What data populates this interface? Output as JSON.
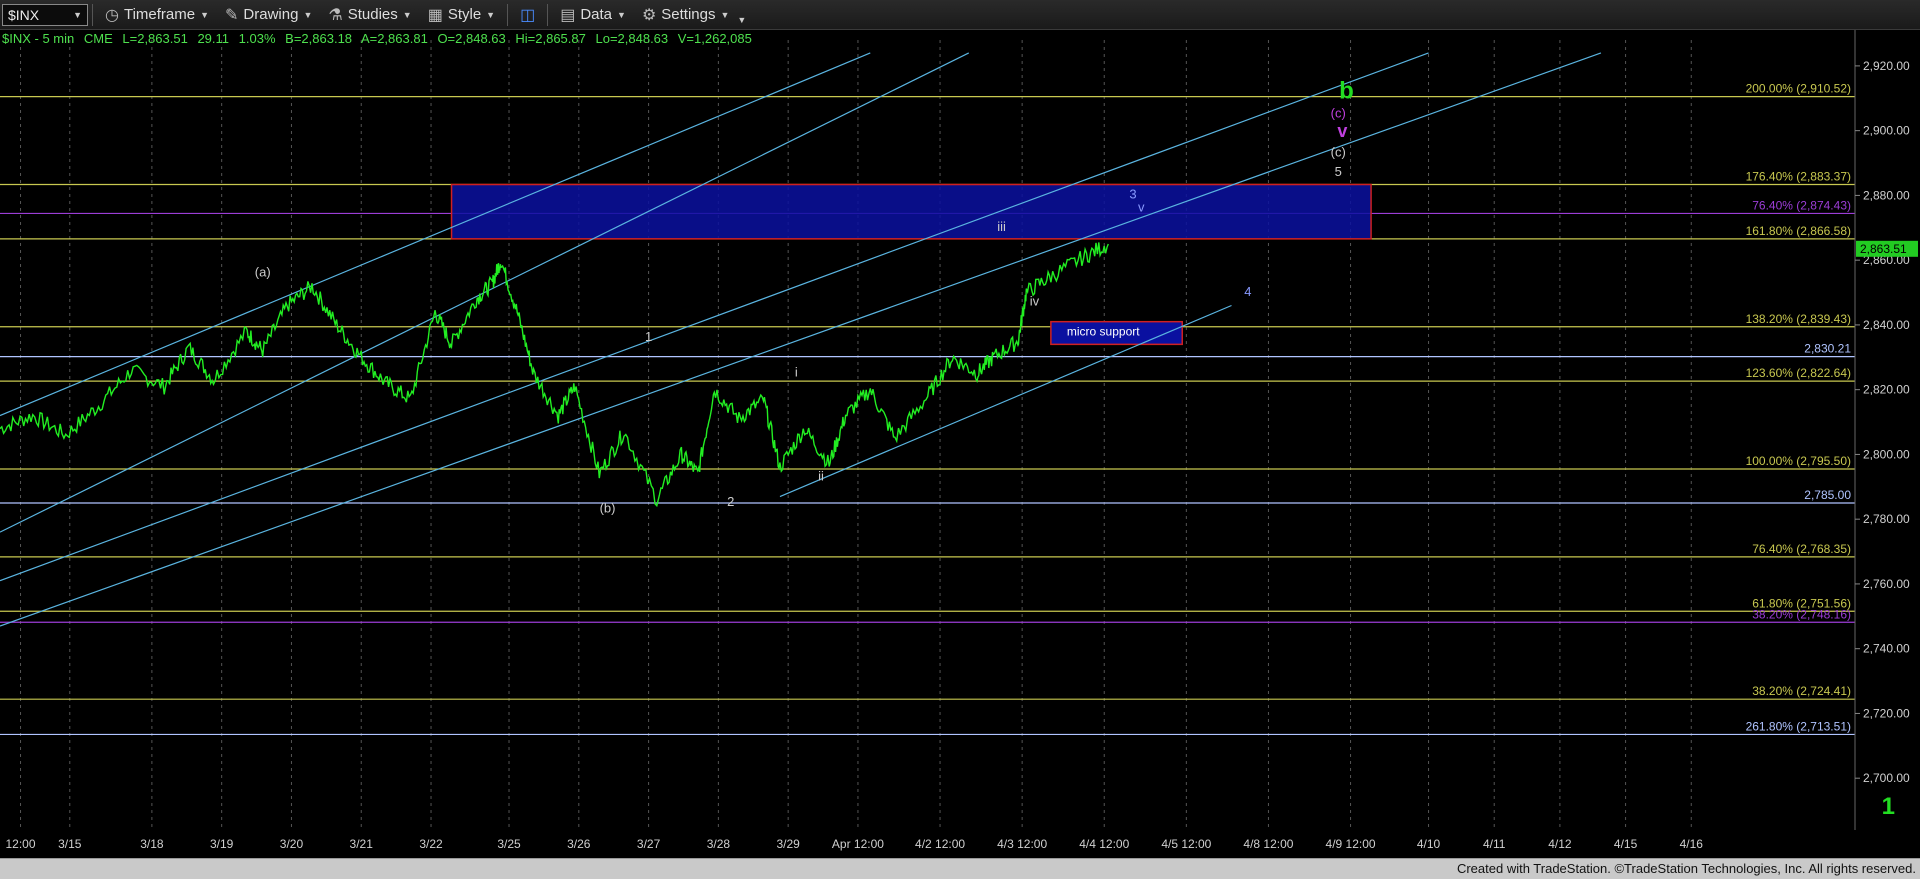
{
  "toolbar": {
    "symbol": "$INX",
    "timeframe_label": "Timeframe",
    "drawing_label": "Drawing",
    "studies_label": "Studies",
    "style_label": "Style",
    "data_label": "Data",
    "settings_label": "Settings"
  },
  "quote": {
    "name": "$INX - 5 min",
    "exchange": "CME",
    "last": "L=2,863.51",
    "change": "29.11",
    "pct": "1.03%",
    "bid": "B=2,863.18",
    "ask": "A=2,863.81",
    "open": "O=2,848.63",
    "high": "Hi=2,865.87",
    "low": "Lo=2,848.63",
    "volume": "V=1,262,085"
  },
  "footer": {
    "credit": "Created with TradeStation. ©TradeStation Technologies, Inc. All rights reserved."
  },
  "chart_data": {
    "type": "line",
    "title": "",
    "ylim": [
      2684,
      2928
    ],
    "x_tick_labels": [
      "12:00",
      "3/15",
      "3/18",
      "3/19",
      "3/20",
      "3/21",
      "3/22",
      "3/25",
      "3/26",
      "3/27",
      "3/28",
      "3/29",
      "Apr 12:00",
      "4/2 12:00",
      "4/3 12:00",
      "4/4 12:00",
      "4/5 12:00",
      "4/8 12:00",
      "4/9 12:00",
      "4/10",
      "4/11",
      "4/12",
      "4/15",
      "4/16"
    ],
    "y_ticks": [
      2700,
      2720,
      2740,
      2760,
      2780,
      2800,
      2820,
      2840,
      2860,
      2880,
      2900,
      2920
    ],
    "y_tick_labels": [
      "2,700.00",
      "2,720.00",
      "2,740.00",
      "2,760.00",
      "2,780.00",
      "2,800.00",
      "2,820.00",
      "2,840.00",
      "2,860.00",
      "2,880.00",
      "2,900.00",
      "2,920.00"
    ],
    "last_price": {
      "value": 2863.51,
      "label": "2,863.51"
    },
    "price_series": {
      "name": "$INX - 5 min",
      "color": "#22ee22",
      "points": [
        [
          0.0,
          2808
        ],
        [
          0.4,
          2812
        ],
        [
          0.8,
          2806
        ],
        [
          1.2,
          2815
        ],
        [
          1.6,
          2826
        ],
        [
          2.0,
          2821
        ],
        [
          2.3,
          2833
        ],
        [
          2.6,
          2823
        ],
        [
          3.0,
          2838
        ],
        [
          3.2,
          2832
        ],
        [
          3.5,
          2846
        ],
        [
          3.8,
          2852
        ],
        [
          4.1,
          2840
        ],
        [
          4.4,
          2830
        ],
        [
          4.7,
          2822
        ],
        [
          5.0,
          2817
        ],
        [
          5.3,
          2844
        ],
        [
          5.5,
          2834
        ],
        [
          5.8,
          2848
        ],
        [
          6.0,
          2853
        ],
        [
          6.1,
          2860
        ],
        [
          6.3,
          2844
        ],
        [
          6.5,
          2825
        ],
        [
          6.8,
          2812
        ],
        [
          7.0,
          2821
        ],
        [
          7.3,
          2794
        ],
        [
          7.6,
          2807
        ],
        [
          8.0,
          2786
        ],
        [
          8.3,
          2800
        ],
        [
          8.5,
          2794
        ],
        [
          8.7,
          2820
        ],
        [
          9.0,
          2811
        ],
        [
          9.3,
          2817
        ],
        [
          9.5,
          2796
        ],
        [
          9.8,
          2808
        ],
        [
          10.1,
          2797
        ],
        [
          10.3,
          2812
        ],
        [
          10.6,
          2820
        ],
        [
          10.9,
          2805
        ],
        [
          11.3,
          2818
        ],
        [
          11.6,
          2830
        ],
        [
          11.9,
          2825
        ],
        [
          12.1,
          2830
        ],
        [
          12.4,
          2835
        ],
        [
          12.5,
          2850
        ],
        [
          12.8,
          2855
        ],
        [
          13.2,
          2861
        ],
        [
          13.5,
          2865
        ]
      ]
    },
    "fib_levels": [
      {
        "label": "200.00% (2,910.52)",
        "value": 2910.52,
        "color": "#c8c850"
      },
      {
        "label": "176.40% (2,883.37)",
        "value": 2883.37,
        "color": "#c8c850"
      },
      {
        "label": "76.40% (2,874.43)",
        "value": 2874.43,
        "color": "#9b3dd6"
      },
      {
        "label": "161.80% (2,866.58)",
        "value": 2866.58,
        "color": "#c8c850"
      },
      {
        "label": "138.20% (2,839.43)",
        "value": 2839.43,
        "color": "#c8c850"
      },
      {
        "label": "2,830.21",
        "value": 2830.21,
        "color": "#b0c4ff"
      },
      {
        "label": "123.60% (2,822.64)",
        "value": 2822.64,
        "color": "#c8c850"
      },
      {
        "label": "100.00% (2,795.50)",
        "value": 2795.5,
        "color": "#c8c850"
      },
      {
        "label": "2,785.00",
        "value": 2785.0,
        "color": "#b0c4ff"
      },
      {
        "label": "76.40% (2,768.35)",
        "value": 2768.35,
        "color": "#c8c850"
      },
      {
        "label": "61.80% (2,751.56)",
        "value": 2751.56,
        "color": "#c8c850"
      },
      {
        "label": "38.20% (2,748.16)",
        "value": 2748.16,
        "color": "#9b3dd6"
      },
      {
        "label": "38.20% (2,724.41)",
        "value": 2724.41,
        "color": "#c8c850"
      },
      {
        "label": "261.80% (2,713.51)",
        "value": 2713.51,
        "color": "#b0c4ff"
      }
    ],
    "channel_lines": [
      {
        "x1": 0.0,
        "y1": 2776,
        "x2": 11.8,
        "y2": 2924
      },
      {
        "x1": 0.0,
        "y1": 2812,
        "x2": 10.6,
        "y2": 2924
      },
      {
        "x1": 0.0,
        "y1": 2761,
        "x2": 17.4,
        "y2": 2924
      },
      {
        "x1": 0.0,
        "y1": 2747,
        "x2": 19.5,
        "y2": 2924
      },
      {
        "x1": 9.5,
        "y1": 2787,
        "x2": 15.0,
        "y2": 2846
      }
    ],
    "resistance_zone": {
      "x1": 5.5,
      "x2": 16.7,
      "y1": 2866.58,
      "y2": 2883.37
    },
    "micro_support": {
      "label": "micro support",
      "x1": 12.8,
      "x2": 14.4,
      "y1": 2834,
      "y2": 2841
    },
    "wave_labels": [
      {
        "text": "(a)",
        "x": 3.2,
        "y": 2855,
        "color": "#cccccc"
      },
      {
        "text": "(b)",
        "x": 7.4,
        "y": 2782,
        "color": "#cccccc"
      },
      {
        "text": "1",
        "x": 7.9,
        "y": 2835,
        "color": "#cccccc"
      },
      {
        "text": "2",
        "x": 8.9,
        "y": 2784,
        "color": "#cccccc"
      },
      {
        "text": "i",
        "x": 9.7,
        "y": 2824,
        "color": "#cccccc"
      },
      {
        "text": "ii",
        "x": 10.0,
        "y": 2792,
        "color": "#cccccc"
      },
      {
        "text": "iii",
        "x": 12.2,
        "y": 2869,
        "color": "#cccccc"
      },
      {
        "text": "iv",
        "x": 12.6,
        "y": 2846,
        "color": "#cccccc"
      },
      {
        "text": "3",
        "x": 13.8,
        "y": 2879,
        "color": "#8899ff"
      },
      {
        "text": "v",
        "x": 13.9,
        "y": 2875,
        "color": "#8899ff"
      },
      {
        "text": "4",
        "x": 15.2,
        "y": 2849,
        "color": "#8899ff"
      },
      {
        "text": "5",
        "x": 16.3,
        "y": 2886,
        "color": "#cccccc"
      },
      {
        "text": "(c)",
        "x": 16.3,
        "y": 2892,
        "color": "#cccccc"
      },
      {
        "text": "(c)",
        "x": 16.3,
        "y": 2904,
        "color": "#c040e0"
      },
      {
        "text": "b",
        "x": 16.4,
        "y": 2910,
        "color": "#22dd22"
      },
      {
        "text": "1",
        "x": 23.0,
        "y": 2689,
        "color": "#22dd22"
      }
    ],
    "wave_marker": {
      "text": "v",
      "x": 16.35,
      "y": 2898,
      "color": "#c040e0"
    }
  }
}
